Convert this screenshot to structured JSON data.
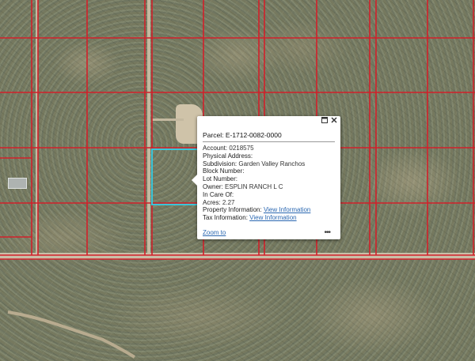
{
  "map": {
    "selected_parcel_color": "#3bc5d8",
    "parcel_line_color": "#d2202a"
  },
  "popup": {
    "title": "Parcel: E-1712-0082-0000",
    "fields": [
      {
        "label": "Account:",
        "value": "0218575"
      },
      {
        "label": "Physical Address:",
        "value": ""
      },
      {
        "label": "Subdivision:",
        "value": "Garden Valley Ranchos"
      },
      {
        "label": "Block Number:",
        "value": ""
      },
      {
        "label": "Lot Number:",
        "value": ""
      },
      {
        "label": "Owner:",
        "value": "ESPLIN RANCH L C"
      },
      {
        "label": "In Care Of:",
        "value": ""
      },
      {
        "label": "Acres:",
        "value": "2.27"
      }
    ],
    "links": [
      {
        "label": "Property Information:",
        "link_text": "View Information"
      },
      {
        "label": "Tax Information:",
        "link_text": "View Information"
      }
    ],
    "zoom_to": "Zoom to",
    "more_icon": "ellipsis-icon",
    "maximize_icon": "maximize-icon",
    "close_icon": "close-icon"
  }
}
